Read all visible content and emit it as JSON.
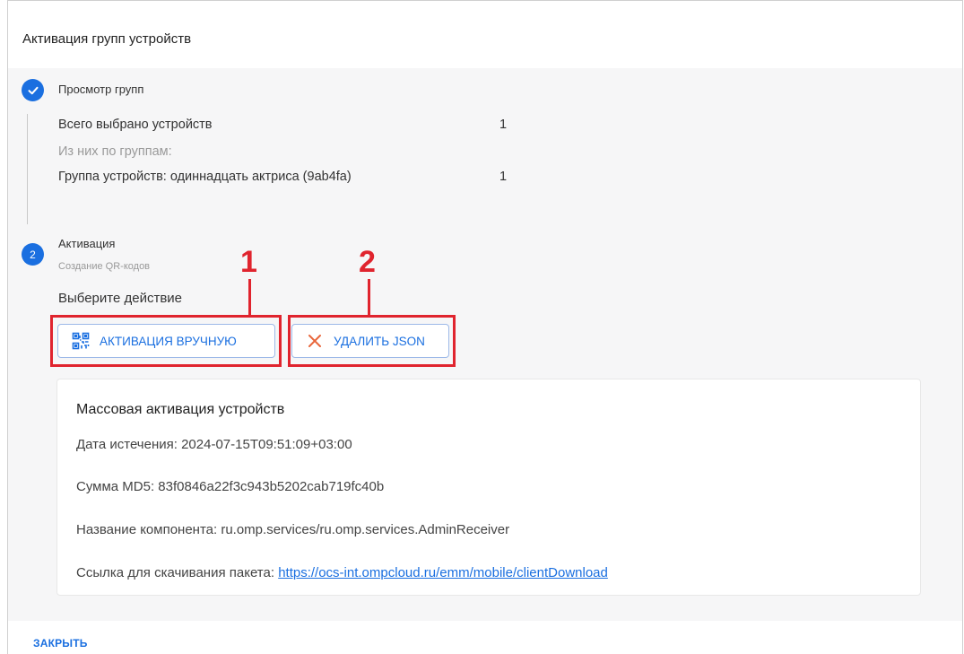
{
  "dialog": {
    "title": "Активация групп устройств",
    "close_label": "ЗАКРЫТЬ"
  },
  "steps": [
    {
      "title": "Просмотр групп",
      "status": "completed",
      "badge": "check-icon",
      "summary": {
        "total_label": "Всего выбрано устройств",
        "total_value": "1",
        "groups_heading": "Из них по группам:",
        "groups": [
          {
            "label": "Группа устройств: одиннадцать актриса (9ab4fa)",
            "value": "1"
          }
        ]
      }
    },
    {
      "number": "2",
      "title": "Активация",
      "subtitle": "Создание QR-кодов",
      "status": "active"
    }
  ],
  "actions": {
    "prompt": "Выберите действие",
    "buttons": [
      {
        "label": "АКТИВАЦИЯ ВРУЧНУЮ",
        "icon": "qr-code-icon"
      },
      {
        "label": "УДАЛИТЬ JSON",
        "icon": "close-x-icon"
      }
    ]
  },
  "annotations": [
    "1",
    "2"
  ],
  "card": {
    "title": "Массовая активация устройств",
    "expiry": "Дата истечения: 2024-07-15T09:51:09+03:00",
    "md5": "Сумма MD5: 83f0846a22f3c943b5202cab719fc40b",
    "component": "Название компонента: ru.omp.services/ru.omp.services.AdminReceiver",
    "download_label": "Ссылка для скачивания пакета: ",
    "download_url": "https://ocs-int.ompcloud.ru/emm/mobile/clientDownload"
  },
  "colors": {
    "accent": "#1a6fe0",
    "highlight": "#e0242e",
    "body_bg": "#f6f6f7"
  }
}
